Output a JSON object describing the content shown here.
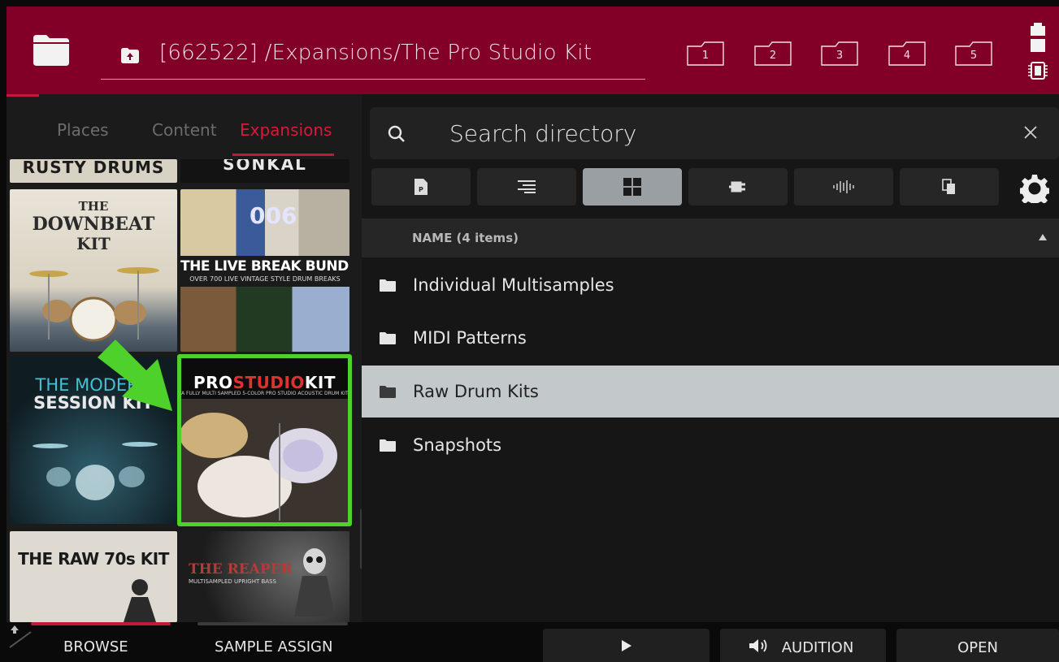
{
  "header": {
    "path": "[662522] /Expansions/The Pro Studio Kit",
    "slots": [
      "1",
      "2",
      "3",
      "4",
      "5"
    ]
  },
  "left_panel": {
    "tabs": [
      "Places",
      "Content",
      "Expansions"
    ],
    "active_tab": "Expansions",
    "tiles": {
      "rusty": "RUSTY DRUMS",
      "sonkal": "SONKAL",
      "downbeat_title": "THE DOWNBEAT KIT",
      "downbeat_top": "THE",
      "downbeat_mid": "DOWNBEAT",
      "downbeat_bot": "KIT",
      "livebreak_title": "THE LIVE BREAK BUNDLE",
      "livebreak_sub": "OVER 700 LIVE VINTAGE STYLE DRUM BREAKS",
      "livebreak_num": "006",
      "modern_top": "THE MODERN",
      "modern_bot": "SESSION KIT",
      "pro_a": "PRO",
      "pro_b": "STUDIO",
      "pro_c": "KIT",
      "pro_sub": "A FULLY MULTI SAMPLED 5-COLOR PRO STUDIO ACOUSTIC DRUM KIT",
      "raw70_title": "THE RAW 70s KIT",
      "reaper_title": "THE REAPER",
      "reaper_sub": "MULTISAMPLED UPRIGHT BASS"
    }
  },
  "search": {
    "placeholder": "Search directory"
  },
  "filter_buttons": [
    "program-icon",
    "list-icon",
    "grid-icon",
    "plugin-icon",
    "waveform-icon",
    "copy-icon"
  ],
  "list": {
    "header": "NAME (4 items)",
    "items": [
      "Individual Multisamples",
      "MIDI Patterns",
      "Raw Drum Kits",
      "Snapshots"
    ],
    "selected": "Raw Drum Kits"
  },
  "bottom": {
    "browse": "BROWSE",
    "sample_assign": "SAMPLE ASSIGN",
    "audition": "AUDITION",
    "open": "OPEN"
  },
  "colors": {
    "header_bg": "#820027",
    "accent_red": "#c2183a",
    "highlight_green": "#4ed12a",
    "selected_row": "#c3c8cb"
  }
}
